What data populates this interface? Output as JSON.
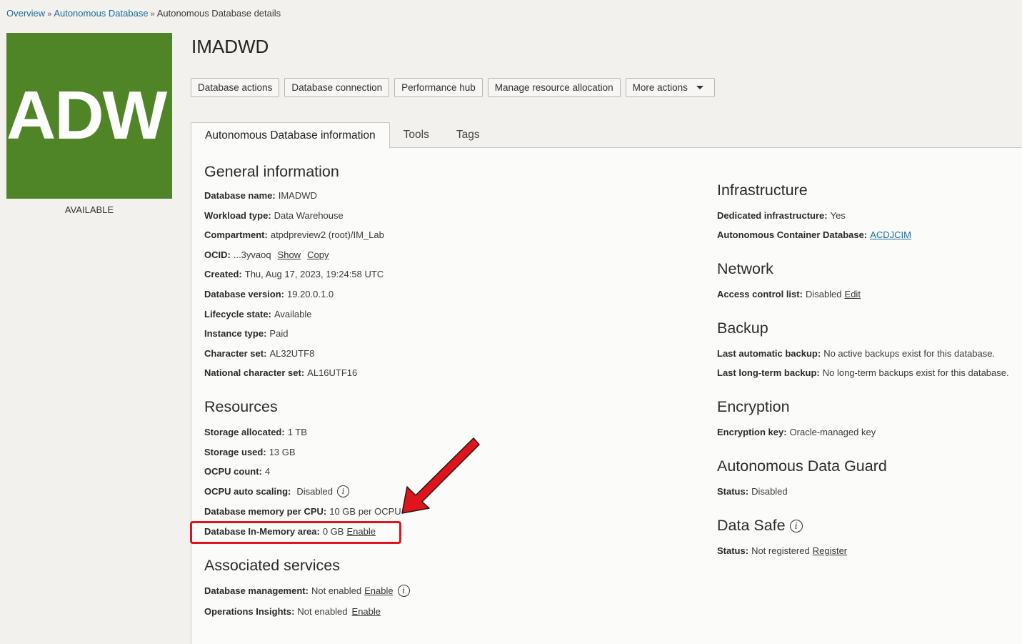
{
  "breadcrumb": {
    "items": [
      "Overview",
      "Autonomous Database"
    ],
    "current": "Autonomous Database details",
    "separator": "»"
  },
  "logo": {
    "text": "ADW",
    "color": "#4f8527"
  },
  "lifecycle_status": "AVAILABLE",
  "title": "IMADWD",
  "actions": {
    "database_actions": "Database actions",
    "database_connection": "Database connection",
    "performance_hub": "Performance hub",
    "manage_resource": "Manage resource allocation",
    "more_actions": "More actions"
  },
  "tabs": {
    "info": "Autonomous Database information",
    "tools": "Tools",
    "tags": "Tags"
  },
  "general": {
    "title": "General information",
    "db_name_label": "Database name:",
    "db_name": "IMADWD",
    "workload_label": "Workload type:",
    "workload": "Data Warehouse",
    "compartment_label": "Compartment:",
    "compartment": "atpdpreview2 (root)/IM_Lab",
    "ocid_label": "OCID:",
    "ocid": "...3yvaoq",
    "ocid_show": "Show",
    "ocid_copy": "Copy",
    "created_label": "Created:",
    "created": "Thu, Aug 17, 2023, 19:24:58 UTC",
    "version_label": "Database version:",
    "version": "19.20.0.1.0",
    "lifecycle_label": "Lifecycle state:",
    "lifecycle": "Available",
    "instance_label": "Instance type:",
    "instance": "Paid",
    "charset_label": "Character set:",
    "charset": "AL32UTF8",
    "ncharset_label": "National character set:",
    "ncharset": "AL16UTF16"
  },
  "resources": {
    "title": "Resources",
    "storage_alloc_label": "Storage allocated:",
    "storage_alloc": "1 TB",
    "storage_used_label": "Storage used:",
    "storage_used": "13 GB",
    "ocpu_label": "OCPU count:",
    "ocpu": "4",
    "autoscale_label": "OCPU auto scaling:",
    "autoscale": "Disabled",
    "mem_label": "Database memory per CPU:",
    "mem": "10 GB per OCPU",
    "inmem_label": "Database In-Memory area:",
    "inmem": "0 GB",
    "inmem_enable": "Enable"
  },
  "associated": {
    "title": "Associated services",
    "mgmt_label": "Database management:",
    "mgmt": "Not enabled",
    "mgmt_enable": "Enable",
    "ops_label": "Operations Insights:",
    "ops": "Not enabled",
    "ops_enable": "Enable"
  },
  "infrastructure": {
    "title": "Infrastructure",
    "dedicated_label": "Dedicated infrastructure:",
    "dedicated": "Yes",
    "acd_label": "Autonomous Container Database:",
    "acd": "ACDJCIM"
  },
  "network": {
    "title": "Network",
    "acl_label": "Access control list:",
    "acl": "Disabled",
    "acl_edit": "Edit"
  },
  "backup": {
    "title": "Backup",
    "auto_label": "Last automatic backup:",
    "auto": "No active backups exist for this database.",
    "long_label": "Last long-term backup:",
    "long": "No long-term backups exist for this database."
  },
  "encryption": {
    "title": "Encryption",
    "key_label": "Encryption key:",
    "key": "Oracle-managed key"
  },
  "data_guard": {
    "title": "Autonomous Data Guard",
    "status_label": "Status:",
    "status": "Disabled"
  },
  "data_safe": {
    "title": "Data Safe",
    "status_label": "Status:",
    "status": "Not registered",
    "register": "Register"
  },
  "annotation": {
    "highlight_color": "#e0141c"
  }
}
